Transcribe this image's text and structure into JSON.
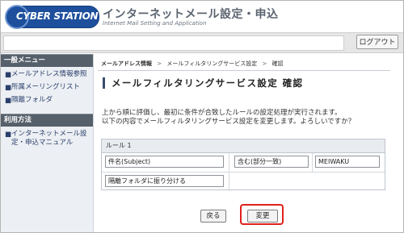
{
  "header": {
    "logo_text": "CYBER STATION",
    "title": "インターネットメール設定・申込",
    "subtitle": "Internet Mail Setting and Application"
  },
  "topbar": {
    "logout_label": "ログアウト"
  },
  "sidebar": {
    "sections": [
      {
        "heading": "一般メニュー",
        "items": [
          {
            "label": "メールアドレス情報参照"
          },
          {
            "label": "所属メーリングリスト"
          },
          {
            "label": "隔離フォルダ"
          }
        ]
      },
      {
        "heading": "利用方法",
        "items": [
          {
            "label": "インターネットメール設定・申込マニュアル"
          }
        ]
      }
    ]
  },
  "main": {
    "breadcrumb": {
      "items": [
        "メールアドレス情報",
        "メールフィルタリングサービス設定",
        "確認"
      ],
      "separator": ">"
    },
    "page_title": "メールフィルタリングサービス設定 確認",
    "description": [
      "上から順に評価し、最初に条件が合致したルールの設定処理が実行されます。",
      "以下の内容でメールフィルタリングサービス設定を変更します。よろしいですか？"
    ],
    "rule": {
      "heading": "ルール 1",
      "field": "件名(Subject)",
      "condition": "含む(部分一致)",
      "value": "MEIWAKU",
      "action": "隔離フォルダに振り分ける"
    },
    "buttons": {
      "back_label": "戻る",
      "change_label": "変更"
    }
  },
  "colors": {
    "sidebar_heading_bg": "#56606b",
    "logo_bg": "#1d4f9c",
    "highlight": "#e0211b",
    "link": "#2a3f6c"
  }
}
